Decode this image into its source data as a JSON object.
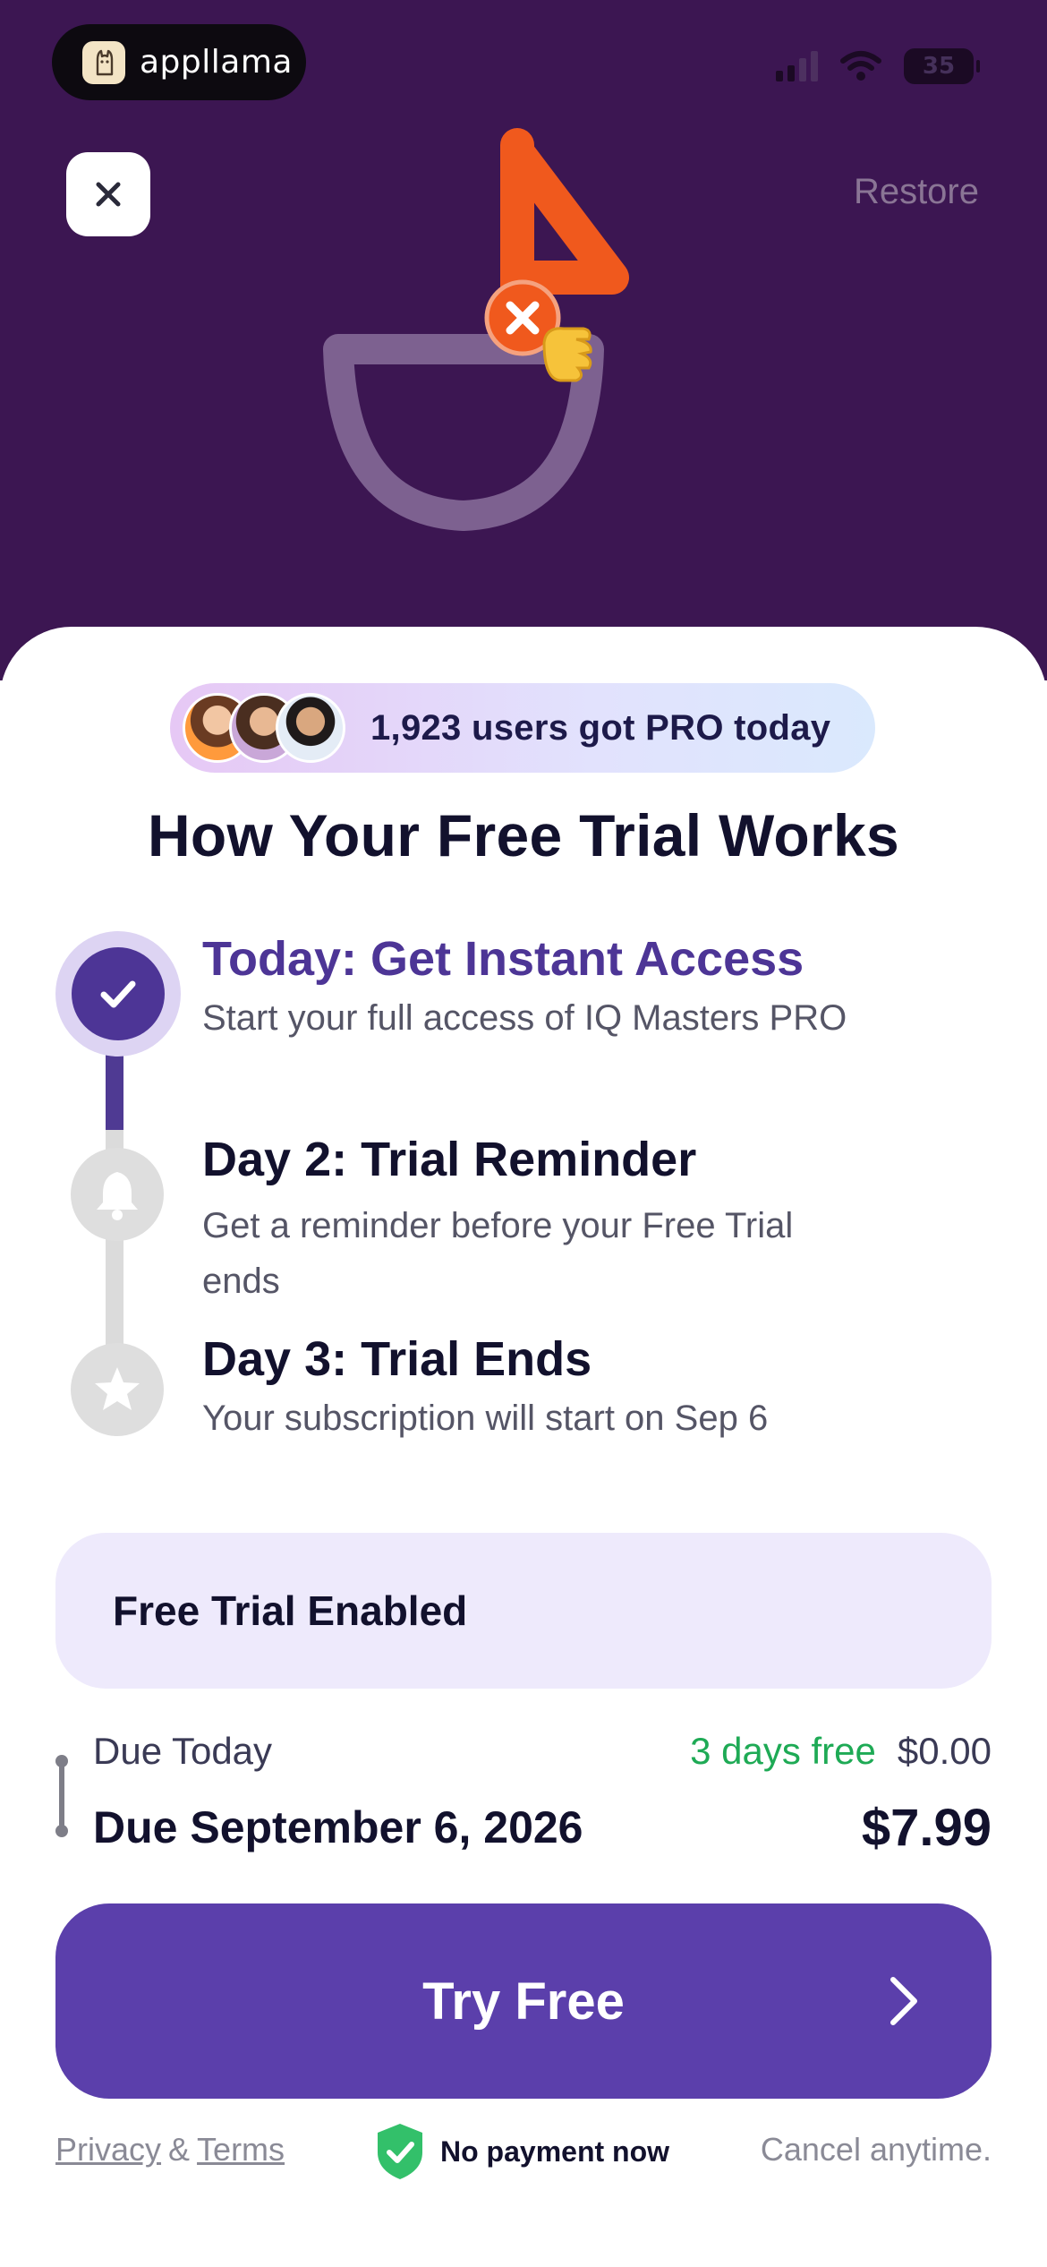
{
  "status_bar": {
    "app_badge_name": "appllama",
    "battery_level": "35"
  },
  "header": {
    "close_icon": "close-icon",
    "restore_label": "Restore"
  },
  "social_proof": {
    "text": "1,923 users got PRO today"
  },
  "title": "How Your Free Trial Works",
  "steps": [
    {
      "title": "Today: Get Instant Access",
      "description": "Start your full access of IQ Masters PRO",
      "icon": "checkmark-icon",
      "status": "active"
    },
    {
      "title": "Day 2: Trial Reminder",
      "description": "Get a reminder before your Free Trial ends",
      "icon": "bell-icon",
      "status": "upcoming"
    },
    {
      "title": "Day 3: Trial Ends",
      "description": "Your subscription will start on Sep 6",
      "icon": "star-icon",
      "status": "upcoming"
    }
  ],
  "free_trial": {
    "label": "Free Trial Enabled"
  },
  "due": {
    "today_label": "Due Today",
    "free_days": "3 days free",
    "today_amount": "$0.00",
    "future_label": "Due September 6, 2026",
    "future_amount": "$7.99"
  },
  "cta": {
    "label": "Try Free",
    "icon": "chevron-right-icon"
  },
  "footer": {
    "privacy": "Privacy",
    "amp": "&",
    "terms": "Terms",
    "no_payment": "No payment now",
    "cancel": "Cancel anytime."
  },
  "colors": {
    "hero_background": "#3c1652",
    "accent": "#5b3fab",
    "active_step": "#4d3596",
    "free_green": "#1eaa55",
    "trial_box": "#eeeafc"
  }
}
